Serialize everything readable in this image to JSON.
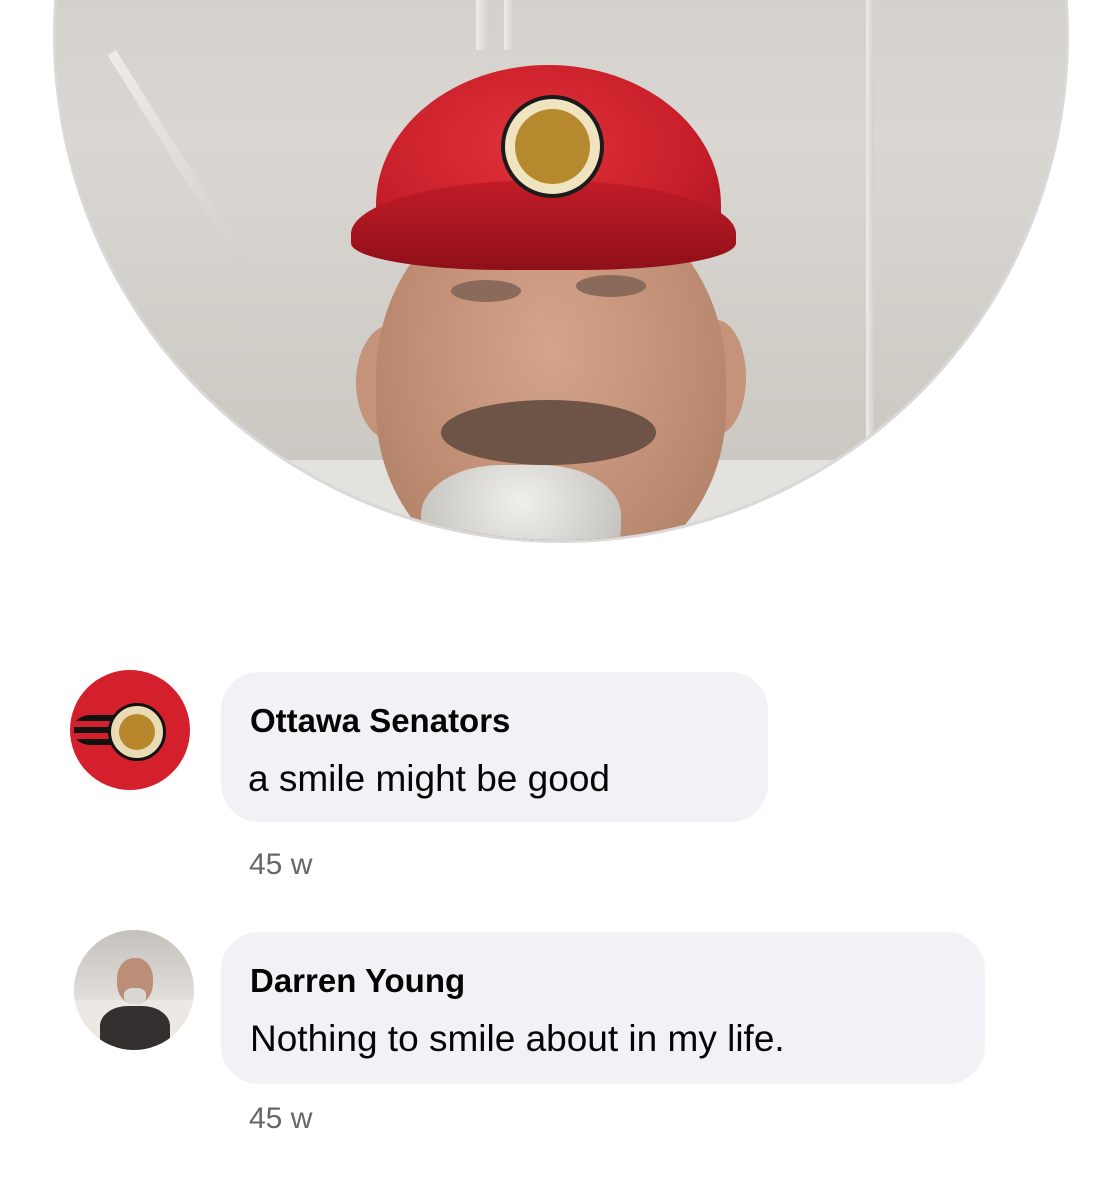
{
  "comments": [
    {
      "author": "Ottawa Senators",
      "text": "a smile might be good",
      "time": "45 w",
      "avatar_icon": "ottawa-senators-logo",
      "brand_color": "#d4202c"
    },
    {
      "author": "Darren Young",
      "text": "Nothing to smile about in my life.",
      "time": "45 w",
      "avatar_icon": "profile-photo"
    }
  ],
  "colors": {
    "bubble_bg": "#f0f2f5",
    "timestamp": "#65676b",
    "text": "#050505"
  }
}
